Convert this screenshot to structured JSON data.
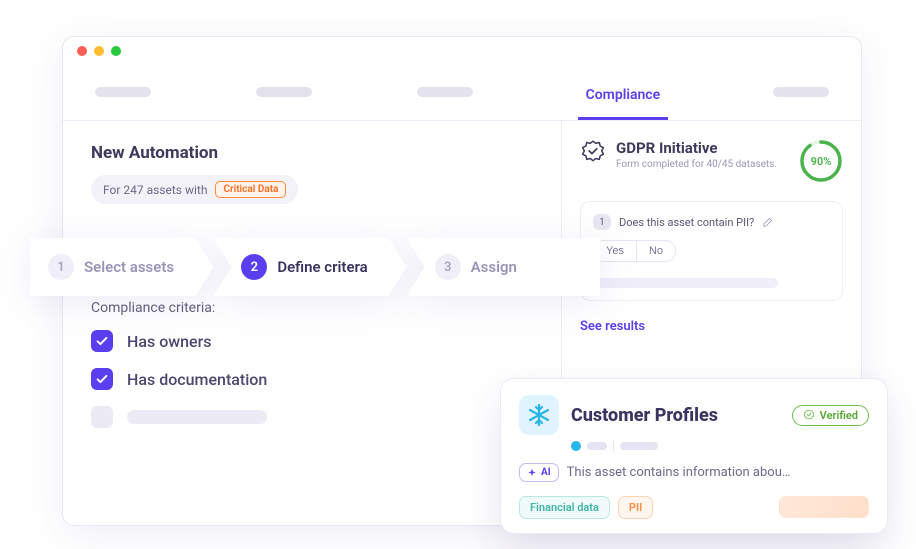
{
  "tabs": {
    "active": "Compliance"
  },
  "automation": {
    "title": "New Automation",
    "for_prefix": "For 247 assets with",
    "tag": "Critical Data"
  },
  "stepper": [
    {
      "num": "1",
      "label": "Select assets"
    },
    {
      "num": "2",
      "label": "Define critera"
    },
    {
      "num": "3",
      "label": "Assign"
    }
  ],
  "criteria": {
    "heading": "Compliance criteria:",
    "items": [
      "Has owners",
      "Has documentation"
    ]
  },
  "gdpr": {
    "title": "GDPR Initiative",
    "subtitle": "Form completed for 40/45 datasets.",
    "percent": "90%"
  },
  "question": {
    "num": "1",
    "text": "Does this asset contain PII?",
    "yes": "Yes",
    "no": "No"
  },
  "see_results": "See results",
  "popup": {
    "title": "Customer Profiles",
    "verified": "Verified",
    "ai_label": "AI",
    "ai_text": "This asset contains information abou…",
    "tags": {
      "financial": "Financial data",
      "pii": "PII"
    }
  }
}
